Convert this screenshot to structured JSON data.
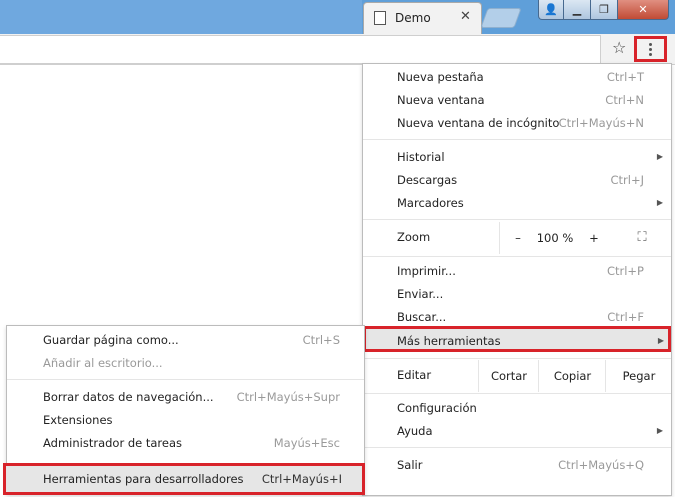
{
  "window": {
    "tab_title": "Demo",
    "tab_close": "✕",
    "controls": {
      "user": "👤",
      "minimize": "▁",
      "maximize": "❐",
      "close": "✕"
    }
  },
  "toolbar": {
    "star_icon": "☆"
  },
  "menu": {
    "new_tab": {
      "label": "Nueva pestaña",
      "shortcut": "Ctrl+T"
    },
    "new_window": {
      "label": "Nueva ventana",
      "shortcut": "Ctrl+N"
    },
    "new_incognito": {
      "label": "Nueva ventana de incógnito",
      "shortcut": "Ctrl+Mayús+N"
    },
    "history": {
      "label": "Historial"
    },
    "downloads": {
      "label": "Descargas",
      "shortcut": "Ctrl+J"
    },
    "bookmarks": {
      "label": "Marcadores"
    },
    "zoom": {
      "label": "Zoom",
      "minus": "–",
      "value": "100 %",
      "plus": "+",
      "fullscreen": "⛶"
    },
    "print": {
      "label": "Imprimir...",
      "shortcut": "Ctrl+P"
    },
    "cast": {
      "label": "Enviar..."
    },
    "find": {
      "label": "Buscar...",
      "shortcut": "Ctrl+F"
    },
    "more_tools": {
      "label": "Más herramientas"
    },
    "edit": {
      "label": "Editar",
      "cut": "Cortar",
      "copy": "Copiar",
      "paste": "Pegar"
    },
    "settings": {
      "label": "Configuración"
    },
    "help": {
      "label": "Ayuda"
    },
    "exit": {
      "label": "Salir",
      "shortcut": "Ctrl+Mayús+Q"
    },
    "arrow": "▶"
  },
  "submenu": {
    "save_page": {
      "label": "Guardar página como...",
      "shortcut": "Ctrl+S"
    },
    "add_desktop": {
      "label": "Añadir al escritorio..."
    },
    "clear_data": {
      "label": "Borrar datos de navegación...",
      "shortcut": "Ctrl+Mayús+Supr"
    },
    "extensions": {
      "label": "Extensiones"
    },
    "task_manager": {
      "label": "Administrador de tareas",
      "shortcut": "Mayús+Esc"
    },
    "dev_tools": {
      "label": "Herramientas para desarrolladores",
      "shortcut": "Ctrl+Mayús+I"
    }
  },
  "colors": {
    "highlight_border": "#d8232a",
    "titlebar": "#6fa8df"
  }
}
